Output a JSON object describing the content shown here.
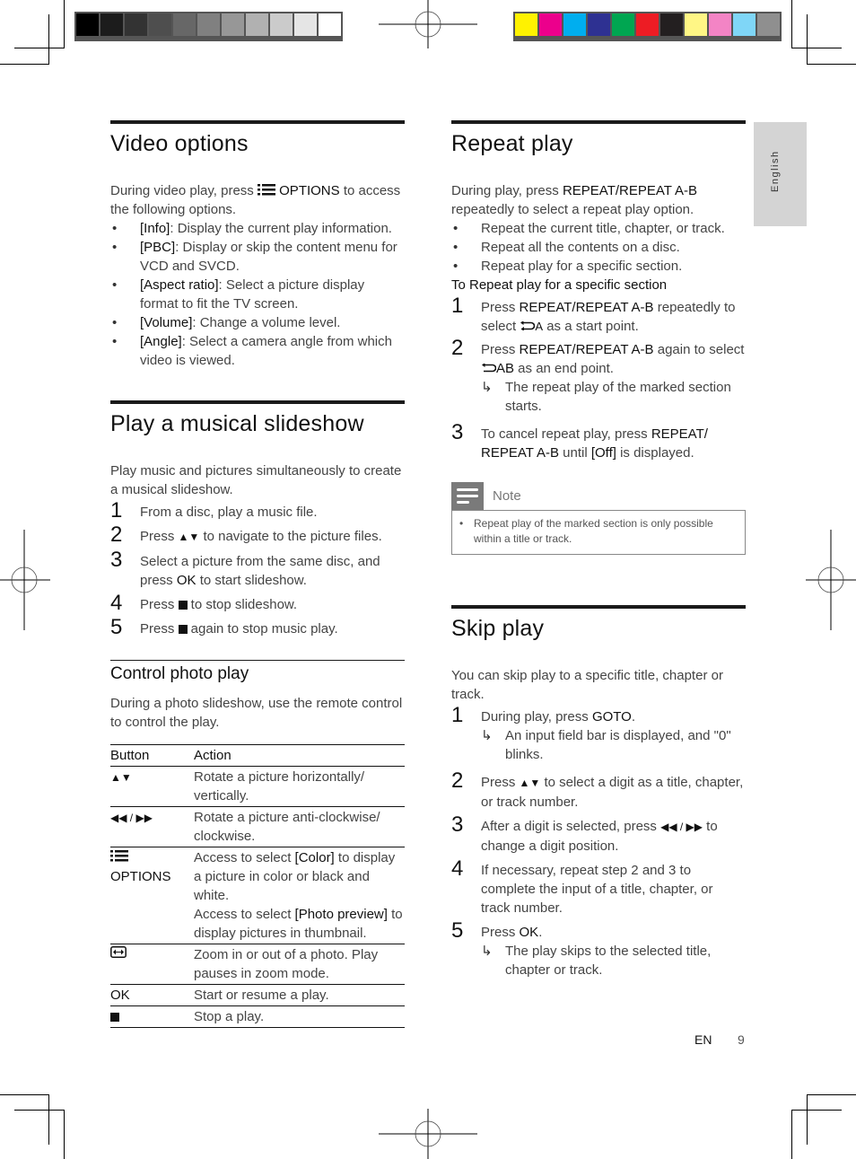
{
  "print_marks": {
    "gray_swatches": [
      "#000000",
      "#1c1c1c",
      "#333333",
      "#4e4e4e",
      "#676767",
      "#808080",
      "#979797",
      "#b1b1b1",
      "#cbcbcb",
      "#e5e5e5",
      "#ffffff"
    ],
    "color_swatches": [
      "#fff200",
      "#ec008c",
      "#00aeef",
      "#2e3192",
      "#00a651",
      "#ed1c24",
      "#231f20",
      "#fff685",
      "#f384c5",
      "#7fd6f7",
      "#8f8f8f"
    ]
  },
  "side_tab": {
    "label": "English"
  },
  "video_options": {
    "title": "Video options",
    "intro_pre": "During video play, press ",
    "intro_key": "OPTIONS",
    "intro_post": " to access the following options.",
    "items": [
      {
        "key": "[Info]",
        "text": ": Display the current play information."
      },
      {
        "key": "[PBC]",
        "text": ": Display or skip the content menu for VCD and SVCD."
      },
      {
        "key": "[Aspect ratio]",
        "text": ": Select a picture display format to fit the TV screen."
      },
      {
        "key": "[Volume]",
        "text": ": Change a volume level."
      },
      {
        "key": "[Angle]",
        "text": ": Select a camera angle from which video is viewed."
      }
    ]
  },
  "slideshow": {
    "title": "Play a musical slideshow",
    "intro": "Play music and pictures simultaneously to create a musical slideshow.",
    "steps": [
      {
        "num": "1",
        "text": "From a disc, play a music file."
      },
      {
        "num": "2",
        "pre": "Press ",
        "post": " to navigate to the picture files."
      },
      {
        "num": "3",
        "pre": "Select a picture from the same disc, and press ",
        "key": "OK",
        "post": " to start slideshow."
      },
      {
        "num": "4",
        "pre": "Press ",
        "post": " to stop slideshow."
      },
      {
        "num": "5",
        "pre": "Press ",
        "post": " again to stop music play."
      }
    ]
  },
  "photo_control": {
    "title": "Control photo play",
    "intro": "During a photo slideshow, use the remote control to control the play.",
    "table": {
      "headers": [
        "Button",
        "Action"
      ],
      "rows": [
        {
          "button": "▲▼",
          "action": "Rotate a picture horizontally/ vertically."
        },
        {
          "button": "◀◀ / ▶▶",
          "action": "Rotate a picture anti-clockwise/ clockwise."
        },
        {
          "button": "OPTIONS",
          "action_1_pre": "Access to select ",
          "action_1_key": "[Color]",
          "action_1_post": " to display a picture in color or black and white.",
          "action_2_pre": "Access to select ",
          "action_2_key": "[Photo preview]",
          "action_2_post": " to display pictures in thumbnail."
        },
        {
          "button": "zoom",
          "action": "Zoom in or out of a photo. Play pauses in zoom mode."
        },
        {
          "button": "OK",
          "action": "Start or resume a play."
        },
        {
          "button": "stop",
          "action": "Stop a play."
        }
      ]
    }
  },
  "repeat_play": {
    "title": "Repeat play",
    "intro_pre": "During play, press ",
    "intro_key": "REPEAT/REPEAT A-B",
    "intro_post": " repeatedly to select a repeat play option.",
    "items": [
      "Repeat the current title, chapter, or track.",
      "Repeat all the contents on a disc.",
      "Repeat play for a specific section."
    ],
    "subhead": "To Repeat play for a specific section",
    "steps": [
      {
        "num": "1",
        "pre": "Press ",
        "key": "REPEAT/REPEAT A-B",
        "mid": " repeatedly to select ",
        "sym": "A",
        "post": " as a start point."
      },
      {
        "num": "2",
        "pre": "Press ",
        "key": "REPEAT/REPEAT A-B",
        "mid": " again to select ",
        "sym": "AB",
        "post": " as an end point.",
        "result": "The repeat play of the marked section starts."
      },
      {
        "num": "3",
        "pre": "To cancel repeat play, press ",
        "key": "REPEAT/ REPEAT A-B",
        "mid": " until ",
        "key2": "[Off]",
        "post": " is displayed."
      }
    ],
    "note": {
      "label": "Note",
      "text": "Repeat play of the marked section is only possible within a title or track."
    }
  },
  "skip_play": {
    "title": "Skip play",
    "intro": "You can skip play to a specific title, chapter or track.",
    "steps": [
      {
        "num": "1",
        "pre": "During play, press ",
        "key": "GOTO",
        "post": ".",
        "result": "An input field bar is displayed, and \"0\" blinks."
      },
      {
        "num": "2",
        "pre": "Press ",
        "post": " to select a digit as a title, chapter, or track number."
      },
      {
        "num": "3",
        "pre": "After a digit is selected, press ",
        "post": " to change a digit position."
      },
      {
        "num": "4",
        "text": "If necessary, repeat step 2 and 3 to complete the input of a title, chapter, or track number."
      },
      {
        "num": "5",
        "pre": "Press ",
        "key": "OK",
        "post": ".",
        "result": "The play skips to the selected title, chapter or track."
      }
    ]
  },
  "footer": {
    "lang": "EN",
    "page": "9"
  }
}
